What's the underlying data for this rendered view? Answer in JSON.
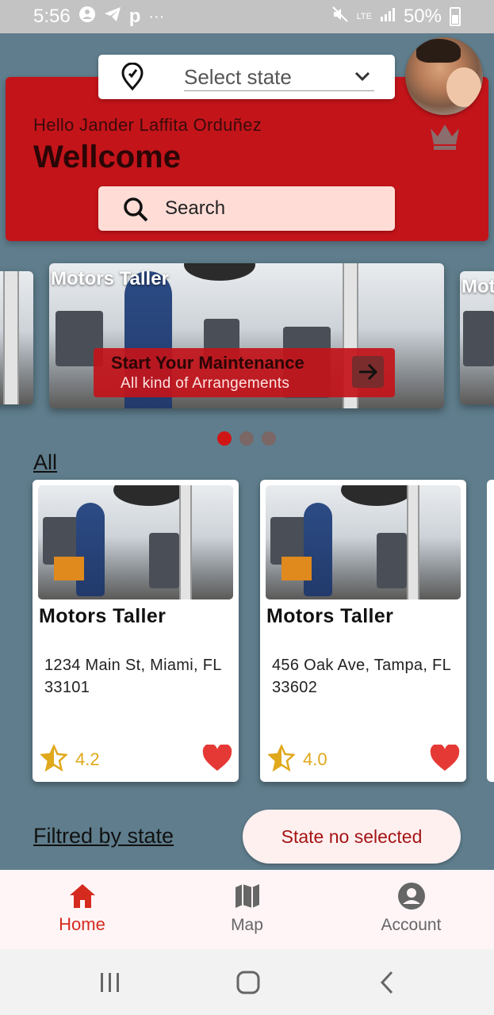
{
  "status_bar": {
    "time": "5:56",
    "left_icons": [
      "face-icon",
      "telegram-icon",
      "p-icon",
      "more-icon"
    ],
    "network": "LTE",
    "battery": "50%"
  },
  "header": {
    "state_select": {
      "value": "Select state",
      "icon": "location-pin-icon"
    },
    "greeting": "Hello Jander Laffita Orduñez",
    "welcome": "Wellcome",
    "search_label": "Search",
    "crown_icon": "crown-icon"
  },
  "carousel": {
    "left_peek_title": "",
    "main": {
      "title": "Motors Taller",
      "cta_title": "Start Your Maintenance",
      "cta_subtitle": "All kind of Arrangements"
    },
    "right_peek_title": "Mot",
    "dots": {
      "count": 3,
      "active": 0
    }
  },
  "sections": {
    "all": "All",
    "filtered": "Filtred by state",
    "state_pill": "State no selected"
  },
  "cards": [
    {
      "name": "Motors Taller",
      "address": "1234 Main St, Miami, FL 33101",
      "rating": "4.2"
    },
    {
      "name": "Motors Taller",
      "address": "456 Oak Ave, Tampa, FL 33602",
      "rating": "4.0"
    }
  ],
  "bottom_nav": [
    {
      "label": "Home",
      "icon": "home-icon",
      "active": true
    },
    {
      "label": "Map",
      "icon": "map-icon",
      "active": false
    },
    {
      "label": "Account",
      "icon": "account-icon",
      "active": false
    }
  ],
  "colors": {
    "background": "#5f7d8c",
    "primary_red": "#c3141a",
    "accent_red": "#d52b1f",
    "star": "#e0a81b",
    "heart": "#e53935"
  }
}
